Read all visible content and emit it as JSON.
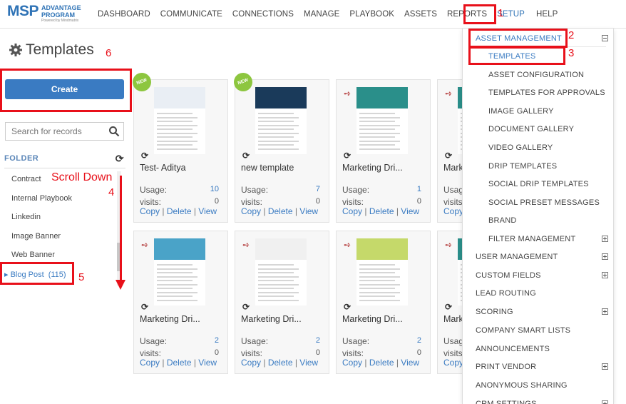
{
  "logo": {
    "brand": "MSP",
    "line1": "ADVANTAGE",
    "line2": "PROGRAM",
    "powered": "Powered by Mindmatrix"
  },
  "nav": [
    {
      "label": "DASHBOARD"
    },
    {
      "label": "COMMUNICATE"
    },
    {
      "label": "CONNECTIONS"
    },
    {
      "label": "MANAGE"
    },
    {
      "label": "PLAYBOOK"
    },
    {
      "label": "ASSETS"
    },
    {
      "label": "REPORTS"
    },
    {
      "label": "SETUP"
    },
    {
      "label": "HELP"
    }
  ],
  "page": {
    "title": "Templates",
    "create_label": "Create",
    "search_placeholder": "Search for records"
  },
  "folder": {
    "heading": "FOLDER",
    "items": [
      "Contract",
      "Internal Playbook",
      "Linkedin",
      "Image Banner",
      "Web Banner"
    ],
    "selected": {
      "label": "Blog Post",
      "count": "(115)"
    }
  },
  "card_labels": {
    "usage": "Usage:",
    "visits": "visits:",
    "copy": "Copy",
    "delete": "Delete",
    "view": "View",
    "new": "NEW"
  },
  "cards": [
    {
      "title": "Test- Aditya",
      "usage": "10",
      "visits": "0",
      "new": true
    },
    {
      "title": "new template",
      "usage": "7",
      "visits": "0",
      "new": true
    },
    {
      "title": "Marketing Dri...",
      "usage": "1",
      "visits": "0",
      "new": false
    },
    {
      "title": "Mark",
      "usage": "",
      "visits": "",
      "new": false
    },
    {
      "title": "Marketing Dri...",
      "usage": "2",
      "visits": "0",
      "new": false
    },
    {
      "title": "Marketing Dri...",
      "usage": "2",
      "visits": "0",
      "new": false
    },
    {
      "title": "Marketing Dri...",
      "usage": "2",
      "visits": "0",
      "new": false
    },
    {
      "title": "Mark",
      "usage": "",
      "visits": "",
      "new": false
    }
  ],
  "dropdown": {
    "asset_management": "ASSET MANAGEMENT",
    "sub": [
      "TEMPLATES",
      "ASSET CONFIGURATION",
      "TEMPLATES FOR APPROVALS",
      "IMAGE GALLERY",
      "DOCUMENT GALLERY",
      "VIDEO GALLERY",
      "DRIP TEMPLATES",
      "SOCIAL DRIP TEMPLATES",
      "SOCIAL PRESET MESSAGES",
      "BRAND",
      "FILTER MANAGEMENT"
    ],
    "main": [
      "USER MANAGEMENT",
      "CUSTOM FIELDS",
      "LEAD ROUTING",
      "SCORING",
      "COMPANY SMART LISTS",
      "ANNOUNCEMENTS",
      "PRINT VENDOR",
      "ANONYMOUS SHARING",
      "CRM SETTINGS"
    ]
  },
  "annotations": {
    "n1": "1",
    "n2": "2",
    "n3": "3",
    "n4": "4",
    "n5": "5",
    "n6": "6",
    "scroll": "Scroll Down"
  },
  "colors": {
    "accent": "#3a7bc2",
    "annotation": "#e8101a",
    "new_badge": "#8dc63f"
  }
}
